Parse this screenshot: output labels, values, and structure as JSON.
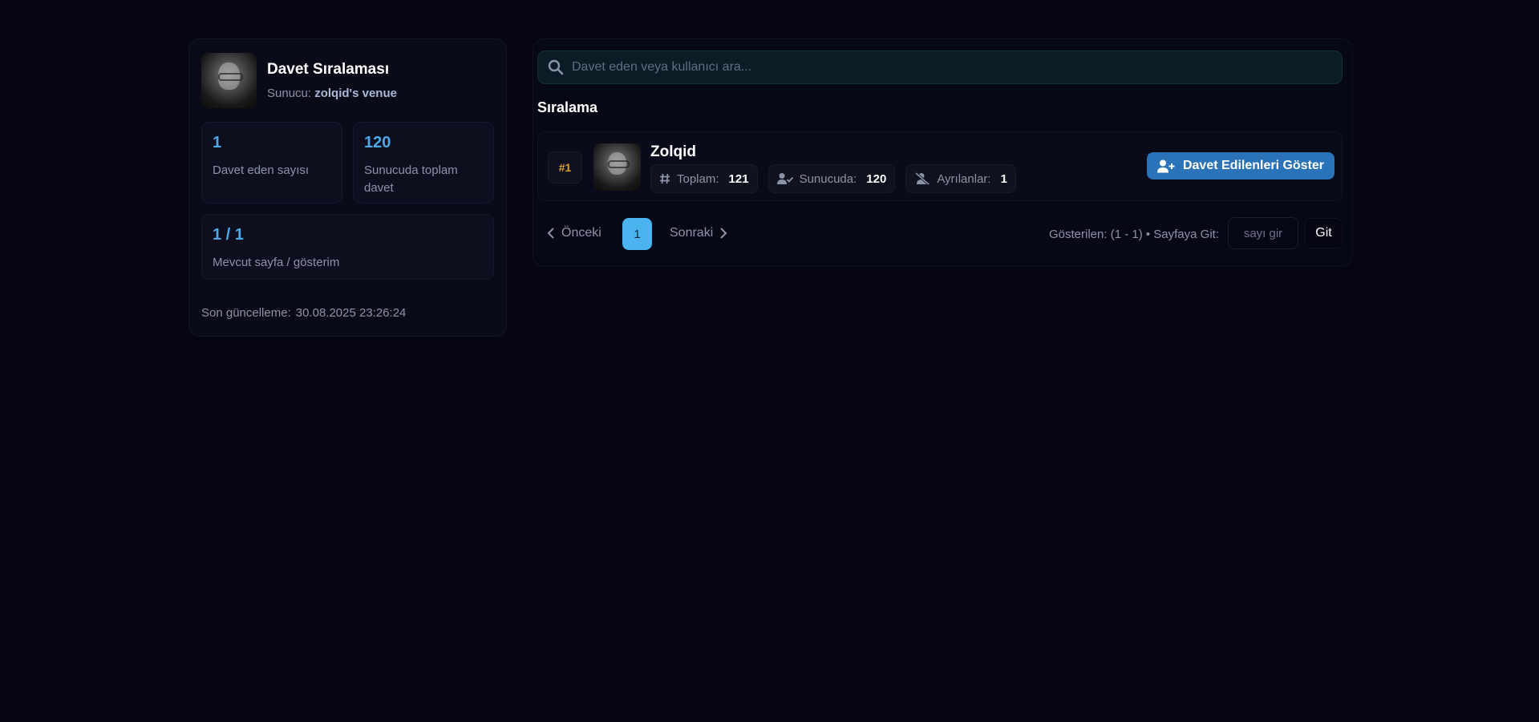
{
  "sidebar": {
    "title": "Davet Sıralaması",
    "host_label": "Sunucu:",
    "host_name": "zolqid's venue",
    "stats": [
      {
        "value": "1",
        "label": "Davet eden sayısı"
      },
      {
        "value": "120",
        "label": "Sunucuda toplam davet"
      },
      {
        "value": "1 / 1",
        "label": "Mevcut sayfa / gösterim"
      }
    ],
    "updated_label": "Son güncelleme:",
    "updated_value": "30.08.2025 23:26:24"
  },
  "search": {
    "placeholder": "Davet eden veya kullanıcı ara..."
  },
  "ranking": {
    "title": "Sıralama",
    "rows": [
      {
        "rank": "#1",
        "name": "Zolqid",
        "total_label": "Toplam:",
        "total": "121",
        "on_server_label": "Sunucuda:",
        "on_server": "120",
        "left_label": "Ayrılanlar:",
        "left": "1",
        "button_label": "Davet Edilenleri Göster"
      }
    ]
  },
  "pagination": {
    "prev_label": "Önceki",
    "current_page": "1",
    "next_label": "Sonraki",
    "info": "Gösterilen: (1 - 1) • Sayfaya Git:",
    "goto_placeholder": "sayı gir",
    "go_label": "Git"
  },
  "colors": {
    "background": "#060613",
    "accent": "#4bb3ee",
    "button": "#2a73b9",
    "rank": "#e0a030"
  }
}
